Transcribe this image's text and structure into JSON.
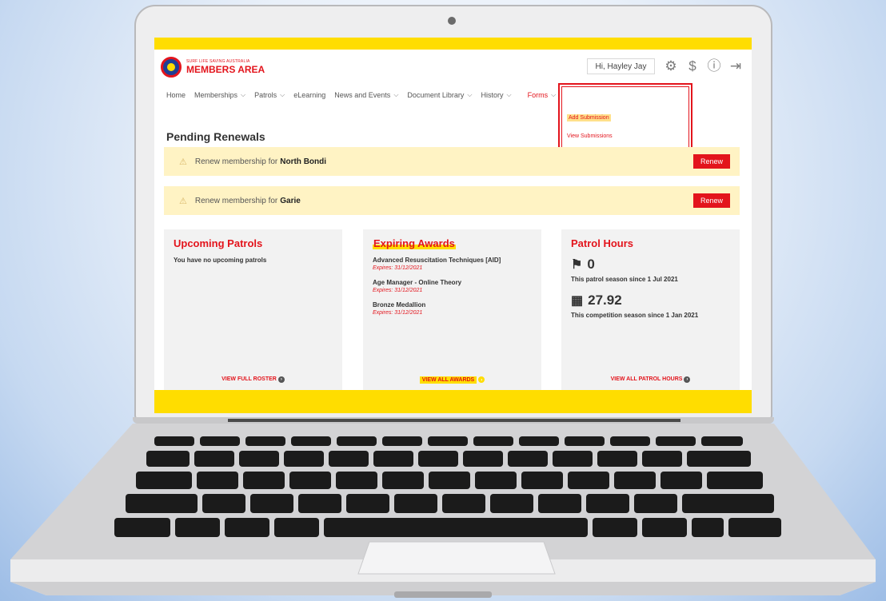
{
  "header": {
    "org_line": "SURF LIFE SAVING AUSTRALIA",
    "brand": "MEMBERS AREA",
    "greeting": "Hi, Hayley Jay",
    "icons": [
      "gear-icon",
      "dollar-icon",
      "help-icon",
      "logout-icon"
    ]
  },
  "nav": {
    "items": [
      {
        "label": "Home",
        "chevron": false
      },
      {
        "label": "Memberships",
        "chevron": true
      },
      {
        "label": "Patrols",
        "chevron": true
      },
      {
        "label": "eLearning",
        "chevron": false
      },
      {
        "label": "News and Events",
        "chevron": true
      },
      {
        "label": "Document Library",
        "chevron": true
      },
      {
        "label": "History",
        "chevron": true
      }
    ],
    "forms_label": "Forms",
    "forms_menu": [
      "Add Submission",
      "View Submissions"
    ]
  },
  "pending": {
    "title": "Pending Renewals",
    "renewals": [
      {
        "prefix": "Renew membership for",
        "club": "North Bondi",
        "button": "Renew"
      },
      {
        "prefix": "Renew membership for",
        "club": "Garie",
        "button": "Renew"
      }
    ]
  },
  "cards": {
    "patrols": {
      "title": "Upcoming Patrols",
      "empty": "You have no upcoming patrols",
      "link": "VIEW FULL ROSTER"
    },
    "awards": {
      "title": "Expiring Awards",
      "items": [
        {
          "name": "Advanced Resuscitation Techniques [AID]",
          "expires": "Expires: 31/12/2021"
        },
        {
          "name": "Age Manager - Online Theory",
          "expires": "Expires: 31/12/2021"
        },
        {
          "name": "Bronze Medallion",
          "expires": "Expires: 31/12/2021"
        }
      ],
      "link": "VIEW ALL AWARDS"
    },
    "hours": {
      "title": "Patrol Hours",
      "patrol_value": "0",
      "patrol_note": "This patrol season since 1 Jul 2021",
      "comp_value": "27.92",
      "comp_note": "This competition season since 1 Jan 2021",
      "link": "VIEW ALL PATROL HOURS"
    }
  },
  "colors": {
    "brand_red": "#e3141c",
    "brand_yellow": "#ffdd00",
    "renewal_bg": "#fff3c4"
  }
}
